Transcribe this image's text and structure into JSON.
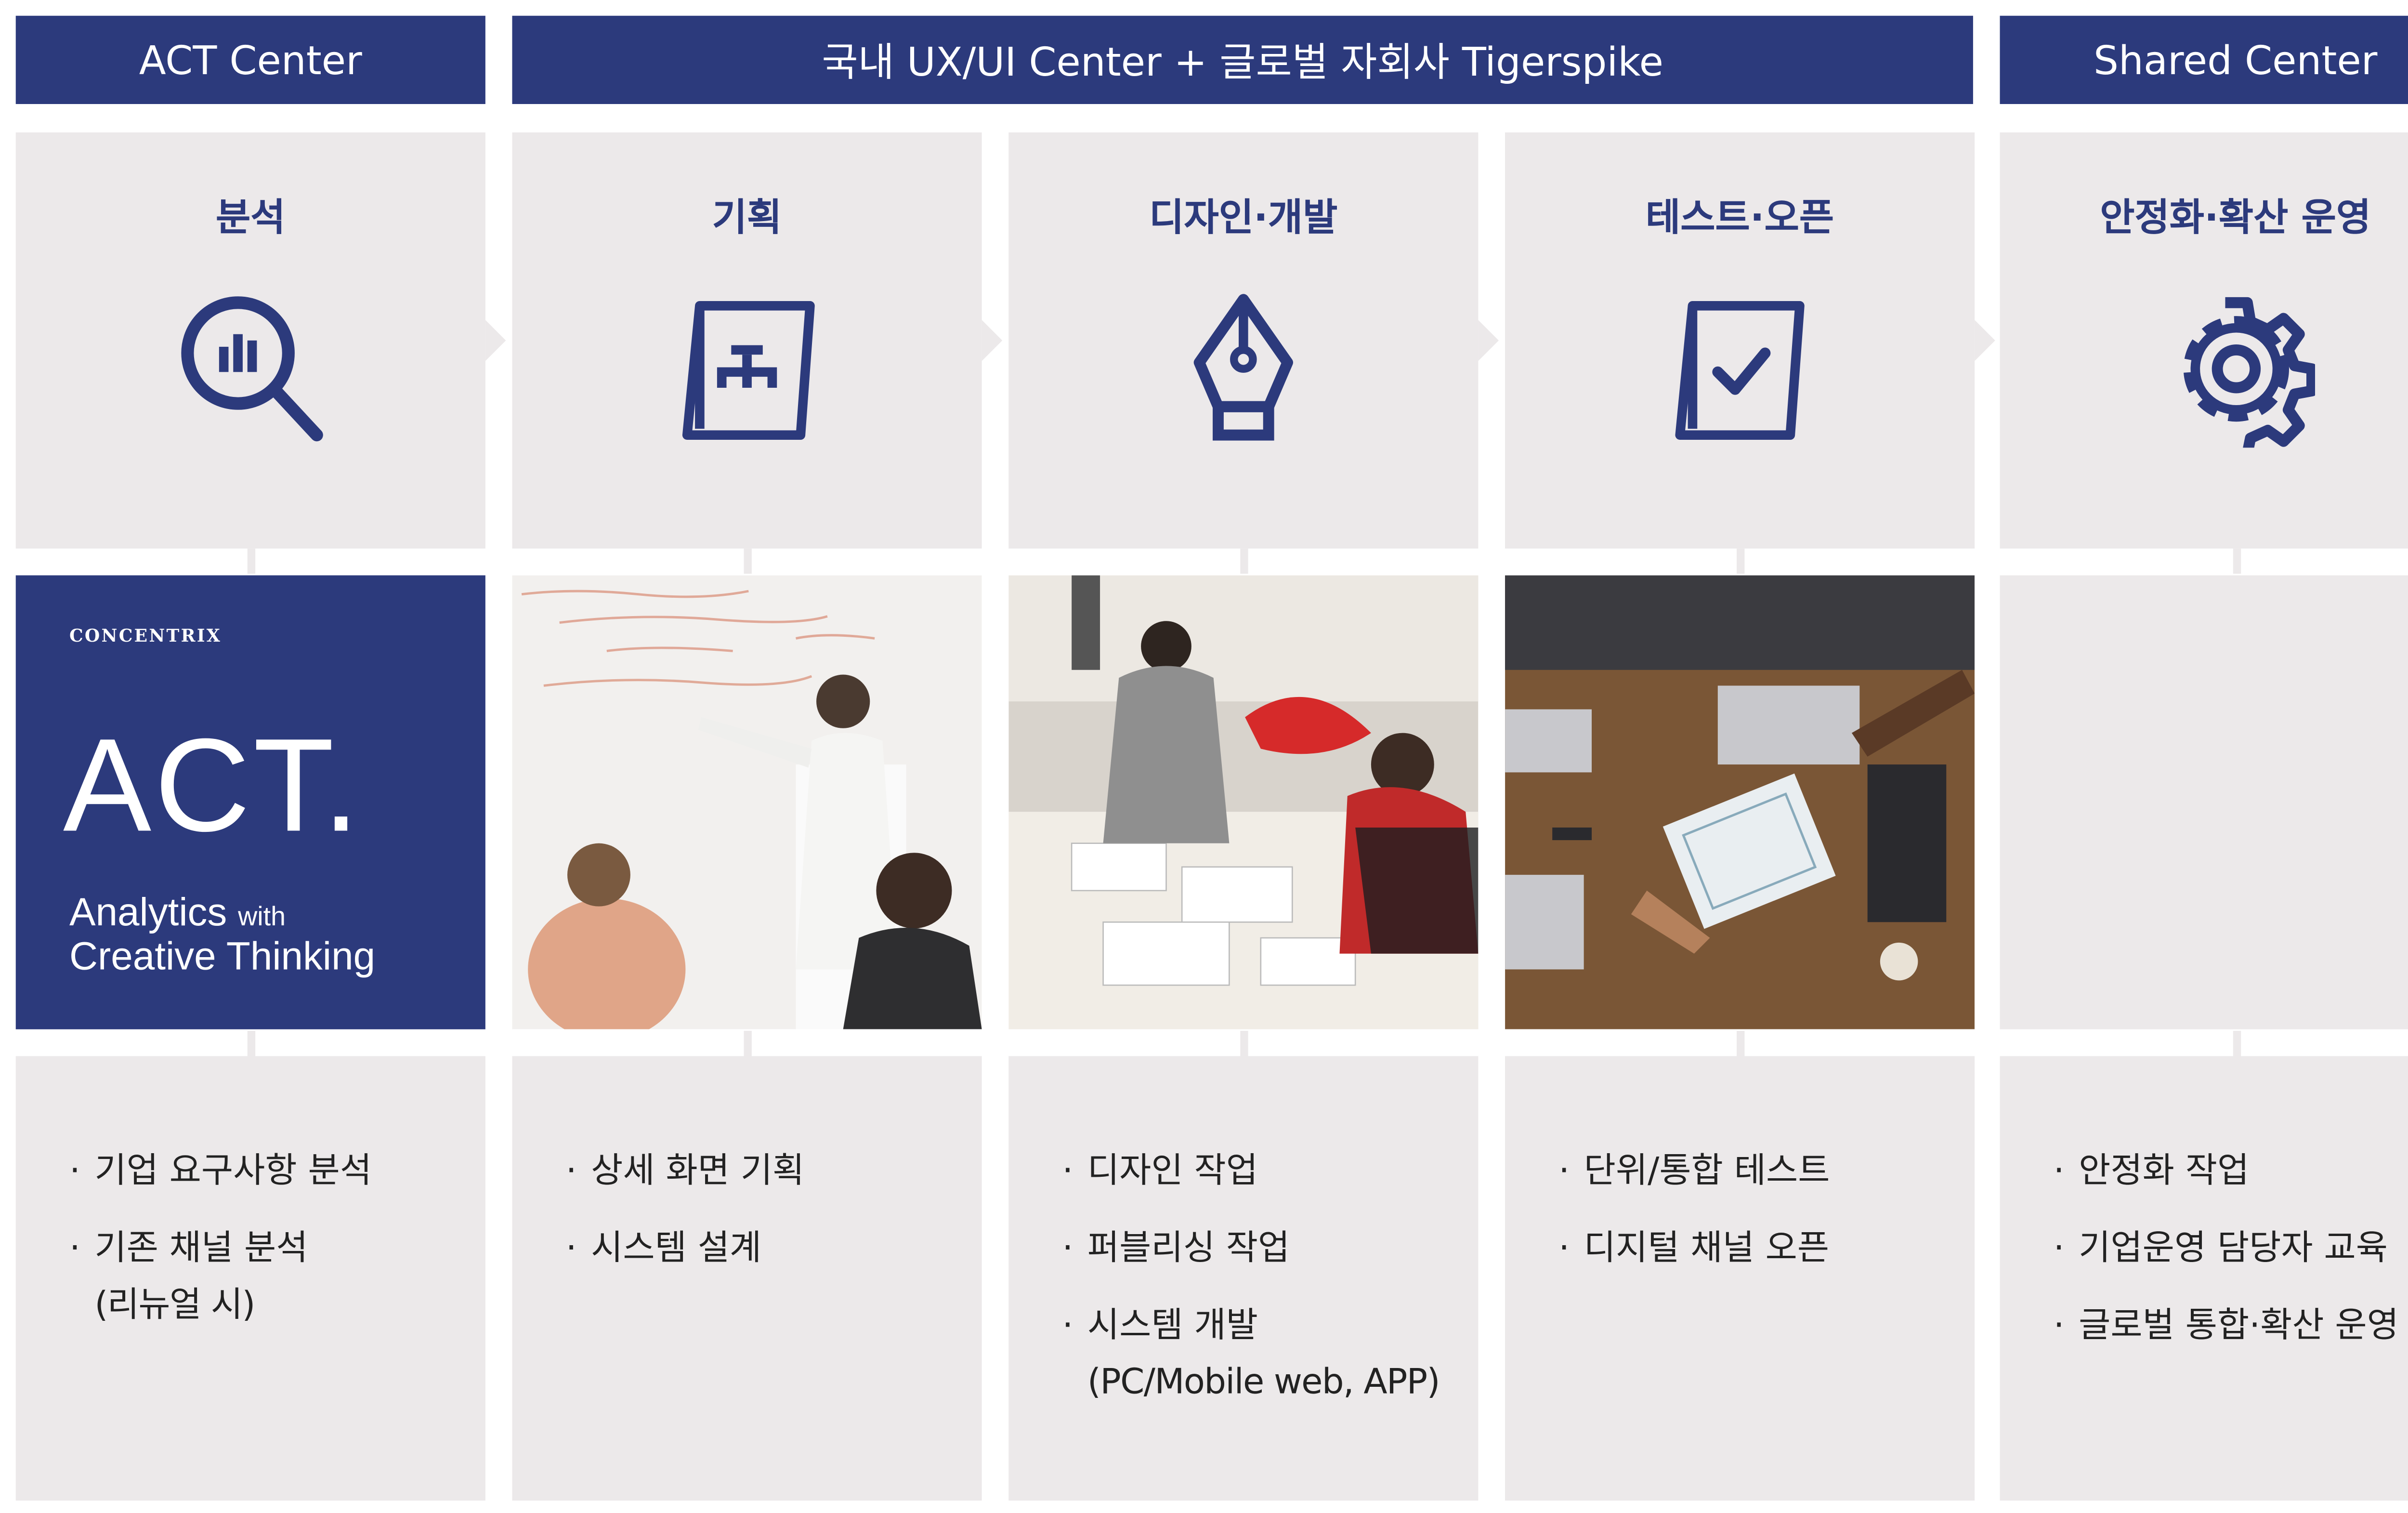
{
  "headers": {
    "act": "ACT Center",
    "ux": "국내 UX/UI Center + 글로벌 자회사 Tigerspike",
    "shared": "Shared Center"
  },
  "steps": [
    {
      "title": "분석",
      "icon": "magnifier-chart-icon"
    },
    {
      "title": "기획",
      "icon": "document-flowchart-icon"
    },
    {
      "title": "디자인·개발",
      "icon": "pen-nib-icon"
    },
    {
      "title": "테스트·오픈",
      "icon": "checklist-document-icon"
    },
    {
      "title": "안정화·확산 운영",
      "icon": "gear-icon"
    }
  ],
  "act_card": {
    "brand": "CONCENTRIX",
    "logo": "ACT.",
    "tagline_1": "Analytics",
    "tagline_with": "with",
    "tagline_2": "Creative Thinking"
  },
  "tasks": [
    {
      "items": [
        {
          "text": "기업 요구사항 분석"
        },
        {
          "text": "기존 채널 분석",
          "sub": "(리뉴얼 시)"
        }
      ]
    },
    {
      "items": [
        {
          "text": "상세 화면 기획"
        },
        {
          "text": "시스템 설계"
        }
      ]
    },
    {
      "items": [
        {
          "text": "디자인 작업"
        },
        {
          "text": "퍼블리싱 작업"
        },
        {
          "text": "시스템 개발",
          "sub": "(PC/Mobile web, APP)"
        }
      ]
    },
    {
      "items": [
        {
          "text": "단위/통합 테스트"
        },
        {
          "text": "디지털 채널 오픈"
        }
      ]
    },
    {
      "items": [
        {
          "text": "안정화 작업"
        },
        {
          "text": "기업운영 담당자 교육"
        },
        {
          "text": "글로벌 통합·확산 운영"
        }
      ]
    }
  ],
  "colors": {
    "navy": "#2c3a7c",
    "panel": "#ece9ea"
  }
}
